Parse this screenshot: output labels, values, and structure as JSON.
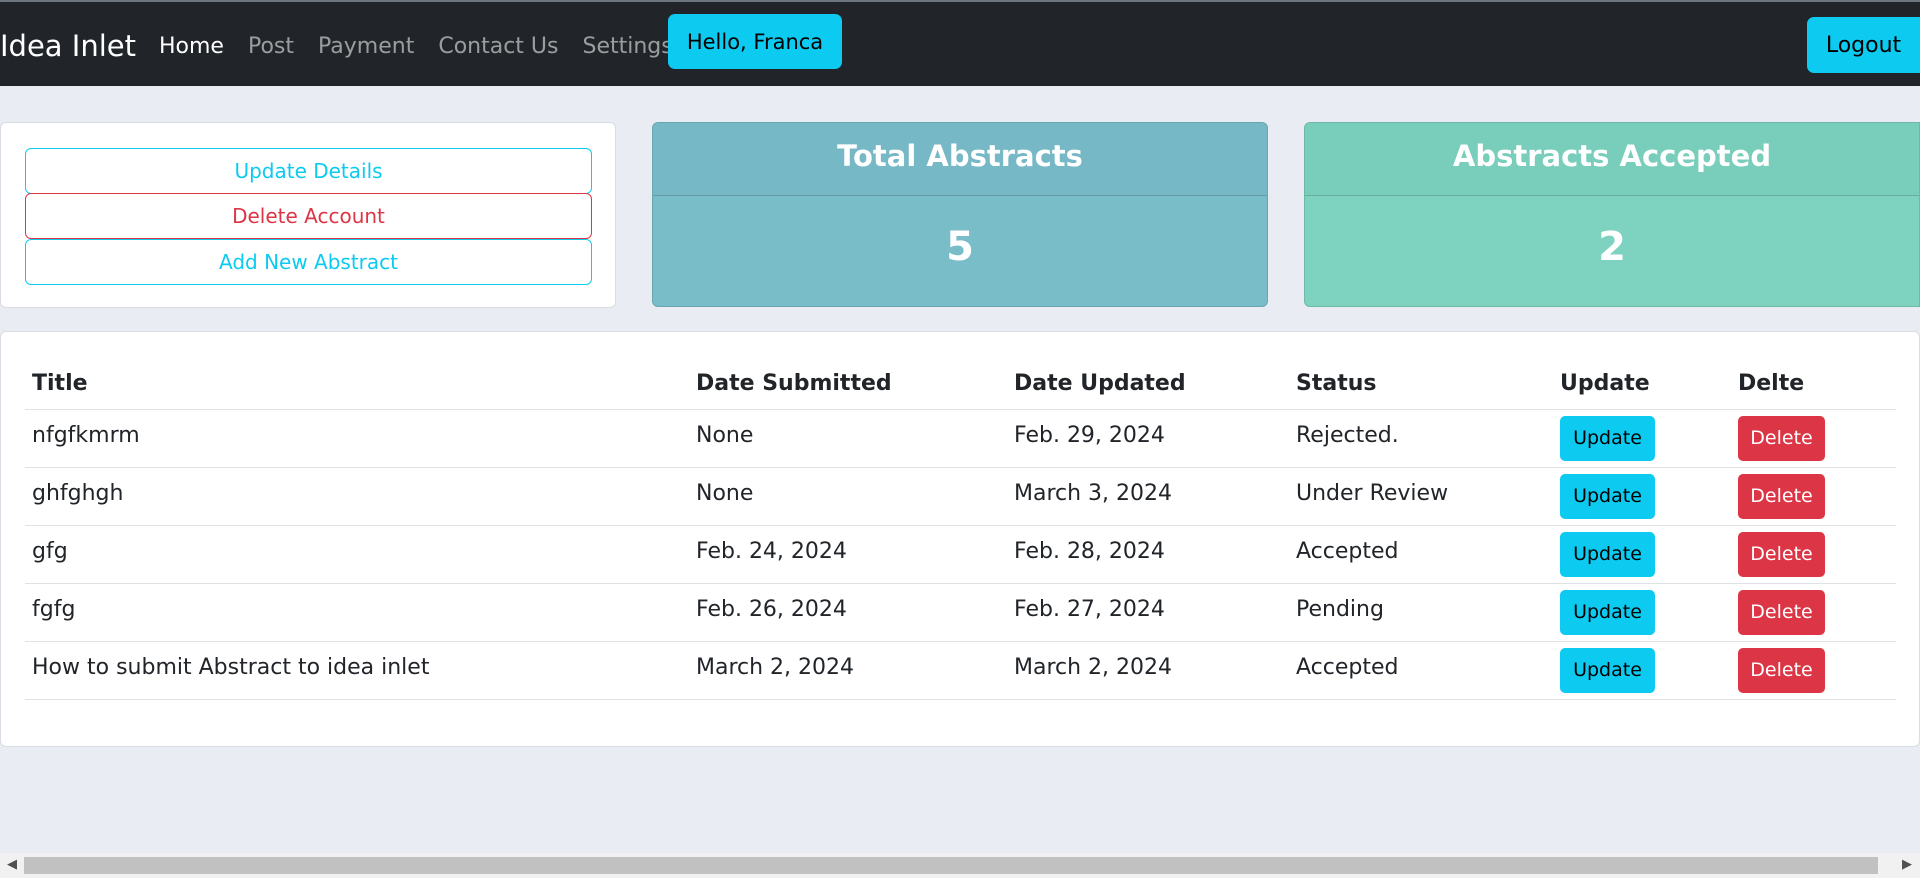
{
  "navbar": {
    "brand": "Idea Inlet",
    "links": [
      "Home",
      "Post",
      "Payment",
      "Contact Us",
      "Settings"
    ],
    "greeting": "Hello, Franca",
    "logout": "Logout"
  },
  "actions": {
    "update_details": "Update Details",
    "delete_account": "Delete Account",
    "add_abstract": "Add New Abstract"
  },
  "stats": {
    "total_label": "Total Abstracts",
    "total_value": "5",
    "accepted_label": "Abstracts Accepted",
    "accepted_value": "2"
  },
  "table": {
    "headers": [
      "Title",
      "Date Submitted",
      "Date Updated",
      "Status",
      "Update",
      "Delte"
    ],
    "update_label": "Update",
    "delete_label": "Delete",
    "rows": [
      {
        "title": "nfgfkmrm",
        "submitted": "None",
        "updated": "Feb. 29, 2024",
        "status": "Rejected."
      },
      {
        "title": "ghfghgh",
        "submitted": "None",
        "updated": "March 3, 2024",
        "status": "Under Review"
      },
      {
        "title": "gfg",
        "submitted": "Feb. 24, 2024",
        "updated": "Feb. 28, 2024",
        "status": "Accepted"
      },
      {
        "title": "fgfg",
        "submitted": "Feb. 26, 2024",
        "updated": "Feb. 27, 2024",
        "status": "Pending"
      },
      {
        "title": "How to submit Abstract to idea inlet",
        "submitted": "March 2, 2024",
        "updated": "March 2, 2024",
        "status": "Accepted"
      }
    ]
  },
  "colors": {
    "navbar": "#212529",
    "info": "#0dcaf0",
    "danger": "#dc3545",
    "total_card": "#79bdc9",
    "accepted_card": "#7dd2c0"
  },
  "icons": {
    "scroll_left": "scroll-left-arrow-icon",
    "scroll_right": "scroll-right-arrow-icon"
  }
}
